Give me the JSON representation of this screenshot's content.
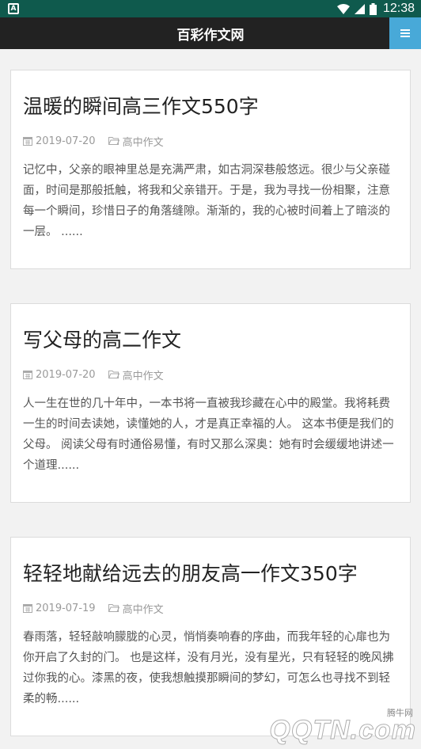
{
  "status_bar": {
    "time": "12:38",
    "app_icon_letter": "A",
    "icons": [
      "wifi-icon",
      "signal-icon",
      "battery-icon"
    ]
  },
  "header": {
    "title": "百彩作文网",
    "menu_icon": "menu-icon",
    "accent_color": "#48a9d8"
  },
  "articles": [
    {
      "title": "温暖的瞬间高三作文550字",
      "date": "2019-07-20",
      "category": "高中作文",
      "excerpt": "记忆中，父亲的眼神里总是充满严肃，如古洞深巷般悠远。很少与父亲碰面，时间是那般抵触，将我和父亲错开。于是，我为寻找一份相聚，注意每一个瞬间，珍惜日子的角落缝隙。渐渐的，我的心被时间着上了暗淡的一层。 ......"
    },
    {
      "title": "写父母的高二作文",
      "date": "2019-07-20",
      "category": "高中作文",
      "excerpt": "人一生在世的几十年中，一本书将一直被我珍藏在心中的殿堂。我将耗费一生的时间去读她，读懂她的人，才是真正幸福的人。 这本书便是我们的父母。 阅读父母有时通俗易懂，有时又那么深奥：她有时会缓缓地讲述一个道理......"
    },
    {
      "title": "轻轻地献给远去的朋友高一作文350字",
      "date": "2019-07-19",
      "category": "高中作文",
      "excerpt": "春雨落，轻轻敲响朦胧的心灵，悄悄奏响春的序曲，而我年轻的心扉也为你开启了久封的门。 也是这样，没有月光，没有星光，只有轻轻的晚风拂过你我的心。漆黑的夜，使我想触摸那瞬间的梦幻，可怎么也寻找不到轻柔的畅......"
    }
  ],
  "watermark": {
    "top_text": "腾牛网",
    "logo_text": "QQTN.com"
  }
}
